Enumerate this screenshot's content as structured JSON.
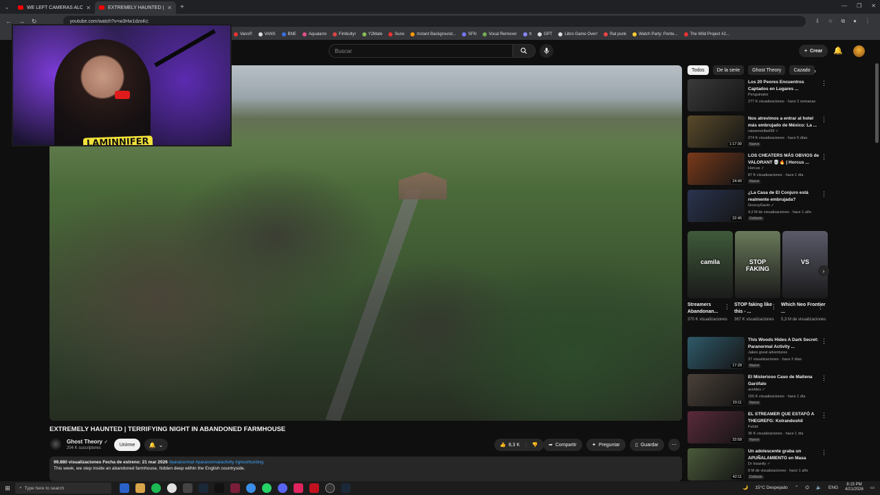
{
  "browser": {
    "tabs": [
      {
        "label": "WE LEFT CAMERAS ALONE in A",
        "active": false
      },
      {
        "label": "EXTREMELY HAUNTED | TERRIFI",
        "active": true
      }
    ],
    "url": "youtube.com/watch?v=w3Hw1dzoKc",
    "bookmarks": [
      "Vans®",
      "VANS",
      "BNE",
      "Aqualarre",
      "Fimbultyr",
      "Y2Mate",
      "Suno",
      "Instant Background...",
      "SFN",
      "Vocal Remover",
      "tt",
      "GPT",
      "Libro Game Over!",
      "Rat punk",
      "Watch Party: Ponte...",
      "The Wild Project #2..."
    ]
  },
  "header": {
    "search_placeholder": "Buscar",
    "create_label": "Crear"
  },
  "streamer": {
    "name": "LAMINNIFER"
  },
  "video": {
    "title": "EXTREMELY HAUNTED | TERRIFYING NIGHT IN ABANDONED FARMHOUSE",
    "channel": "Ghost Theory",
    "subscribers": "204 K suscriptores",
    "join_label": "Unirme",
    "likes": "8,3 K",
    "share_label": "Compartir",
    "ask_label": "Preguntar",
    "save_label": "Guardar",
    "views": "99.880 visualizaciones",
    "premiere": "Fecha de estreno: 21 mar 2026",
    "hashtags": "#paranormal #paranormalactivity #ghosthunting",
    "description": "This week, we step inside an abandoned farmhouse, hidden deep within the English countryside."
  },
  "chips": [
    "Todos",
    "De la serie",
    "Ghost Theory",
    "Cazado"
  ],
  "recommendations": [
    {
      "title": "Los 20 Peores Encuentros Captados en Lugares ...",
      "channel": "Penguinator",
      "views": "277 K visualizaciones · hace 2 semanas",
      "duration": "",
      "badge": "",
      "thumb": "#3a3a3a"
    },
    {
      "title": "Nos atrevimos a entrar al hotel más embrujado de México: La ...",
      "channel": "raizarevelleel99 ✓",
      "views": "274 K visualizaciones · hace 5 días",
      "duration": "1:17:39",
      "badge": "Nuevo",
      "thumb": "#5a4a2a"
    },
    {
      "title": "LOS CHEATERS MÁS OBVIOS de VALORANT 💀🔥 | Horcus ...",
      "channel": "Horcus ✓",
      "views": "87 K visualizaciones · hace 1 día",
      "duration": "24:40",
      "badge": "Nuevo",
      "thumb": "#7a3a1a"
    },
    {
      "title": "¿La Casa de El Conjuro está realmente embrujada?",
      "channel": "GroovyGavin ✓",
      "views": "4,2 M de visualizaciones · hace 1 año",
      "duration": "22:45",
      "badge": "Doblado",
      "thumb": "#2a3450"
    },
    {
      "title": "This Woods Hides A Dark Secret: Paranormal Activity ...",
      "channel": "Jakes great adventures",
      "views": "37 visualizaciones · hace 2 días",
      "duration": "17:28",
      "badge": "Nuevo",
      "thumb": "#2f5a6a"
    },
    {
      "title": "El Misterioso Caso de Maitena Garófalo",
      "channel": "axeldes ✓",
      "views": "155 K visualizaciones · hace 1 día",
      "duration": "20:11",
      "badge": "Nuevo",
      "thumb": "#4a4038"
    },
    {
      "title": "EL STREAMER QUE ESTAFÓ A THEGREFG: Kolrandoshil",
      "channel": "Fulutz",
      "views": "36 K visualizaciones · hace 1 día",
      "duration": "33:58",
      "badge": "Nuevo",
      "thumb": "#5a2a3a"
    },
    {
      "title": "Un adolescente graba un APUÑALAMIENTO en Masa",
      "channel": "Dr Insanity ✓",
      "views": "8 M de visualizaciones · hace 1 año",
      "duration": "42:11",
      "badge": "Doblado",
      "thumb": "#4a5a3a"
    }
  ],
  "shorts": [
    {
      "title": "Streamers Abandonan...",
      "views": "370 K visualizaciones",
      "label": "camila",
      "thumb": "#3f5a3a"
    },
    {
      "title": "STOP faking like this - ...",
      "views": "367 K visualizaciones",
      "label": "STOP FAKING",
      "thumb": "#6a7a5a"
    },
    {
      "title": "Which Neo Frontier ...",
      "views": "5,3 M de visualizaciones",
      "label": "VS",
      "thumb": "#5a5a6a"
    }
  ],
  "taskbar": {
    "search_placeholder": "Type here to search",
    "weather": "15°C Despejado",
    "lang": "ENG",
    "time": "8:15 PM",
    "date": "4/21/2026"
  }
}
